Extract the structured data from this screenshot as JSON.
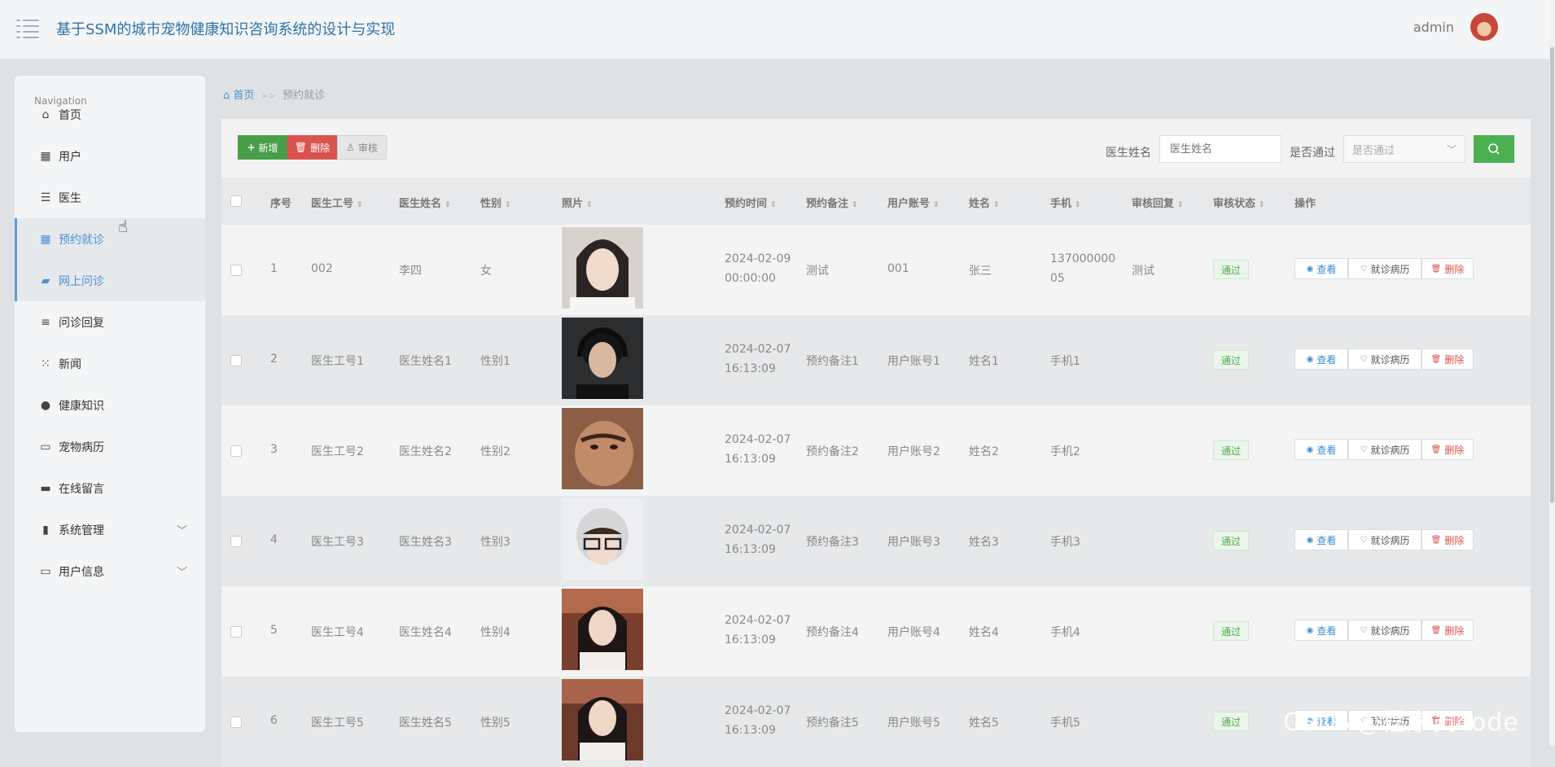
{
  "header": {
    "title": "基于SSM的城市宠物健康知识咨询系统的设计与实现",
    "user": "admin"
  },
  "sidebar": {
    "heading": "Navigation",
    "items": [
      {
        "label": "首页",
        "icon": "home-icon"
      },
      {
        "label": "用户",
        "icon": "grid-icon"
      },
      {
        "label": "医生",
        "icon": "sliders-icon"
      },
      {
        "label": "预约就诊",
        "icon": "grid-icon",
        "active": true
      },
      {
        "label": "网上问诊",
        "icon": "folder-icon",
        "active": true
      },
      {
        "label": "问诊回复",
        "icon": "list-icon"
      },
      {
        "label": "新闻",
        "icon": "apps-icon"
      },
      {
        "label": "健康知识",
        "icon": "user-icon"
      },
      {
        "label": "宠物病历",
        "icon": "monitor-icon"
      },
      {
        "label": "在线留言",
        "icon": "printer-icon"
      },
      {
        "label": "系统管理",
        "icon": "chart-icon",
        "expandable": true
      },
      {
        "label": "用户信息",
        "icon": "card-icon",
        "expandable": true
      }
    ]
  },
  "breadcrumb": {
    "home": "首页",
    "separator": ">>",
    "current": "预约就诊"
  },
  "toolbar": {
    "add": "新增",
    "delete": "删除",
    "audit": "审核"
  },
  "search": {
    "doctor_label": "医生姓名",
    "doctor_placeholder": "医生姓名",
    "pass_label": "是否通过",
    "pass_placeholder": "是否通过"
  },
  "table": {
    "headers": [
      "序号",
      "医生工号",
      "医生姓名",
      "性别",
      "照片",
      "预约时间",
      "预约备注",
      "用户账号",
      "姓名",
      "手机",
      "审核回复",
      "审核状态",
      "操作"
    ],
    "actions": {
      "view": "查看",
      "record": "就诊病历",
      "delete": "删除"
    },
    "rows": [
      {
        "no": "1",
        "doc_id": "002",
        "doc_name": "李四",
        "gender": "女",
        "time1": "2024-02-09",
        "time2": "00:00:00",
        "note": "测试",
        "account": "001",
        "name": "张三",
        "phone1": "137000000",
        "phone2": "05",
        "reply": "测试",
        "status": "通过"
      },
      {
        "no": "2",
        "doc_id": "医生工号1",
        "doc_name": "医生姓名1",
        "gender": "性别1",
        "time1": "2024-02-07",
        "time2": "16:13:09",
        "note": "预约备注1",
        "account": "用户账号1",
        "name": "姓名1",
        "phone1": "手机1",
        "phone2": "",
        "reply": "",
        "status": "通过"
      },
      {
        "no": "3",
        "doc_id": "医生工号2",
        "doc_name": "医生姓名2",
        "gender": "性别2",
        "time1": "2024-02-07",
        "time2": "16:13:09",
        "note": "预约备注2",
        "account": "用户账号2",
        "name": "姓名2",
        "phone1": "手机2",
        "phone2": "",
        "reply": "",
        "status": "通过"
      },
      {
        "no": "4",
        "doc_id": "医生工号3",
        "doc_name": "医生姓名3",
        "gender": "性别3",
        "time1": "2024-02-07",
        "time2": "16:13:09",
        "note": "预约备注3",
        "account": "用户账号3",
        "name": "姓名3",
        "phone1": "手机3",
        "phone2": "",
        "reply": "",
        "status": "通过"
      },
      {
        "no": "5",
        "doc_id": "医生工号4",
        "doc_name": "医生姓名4",
        "gender": "性别4",
        "time1": "2024-02-07",
        "time2": "16:13:09",
        "note": "预约备注4",
        "account": "用户账号4",
        "name": "姓名4",
        "phone1": "手机4",
        "phone2": "",
        "reply": "",
        "status": "通过"
      },
      {
        "no": "6",
        "doc_id": "医生工号5",
        "doc_name": "医生姓名5",
        "gender": "性别5",
        "time1": "2024-02-07",
        "time2": "16:13:09",
        "note": "预约备注5",
        "account": "用户账号5",
        "name": "姓名5",
        "phone1": "手机5",
        "phone2": "",
        "reply": "",
        "status": "通过"
      }
    ]
  },
  "watermark": "CSDN@程序员code",
  "colors": {
    "accent": "#4a8fcf",
    "add": "#4a9e4a",
    "delete": "#d9534f",
    "search": "#4caf50",
    "status": "#53a853"
  }
}
